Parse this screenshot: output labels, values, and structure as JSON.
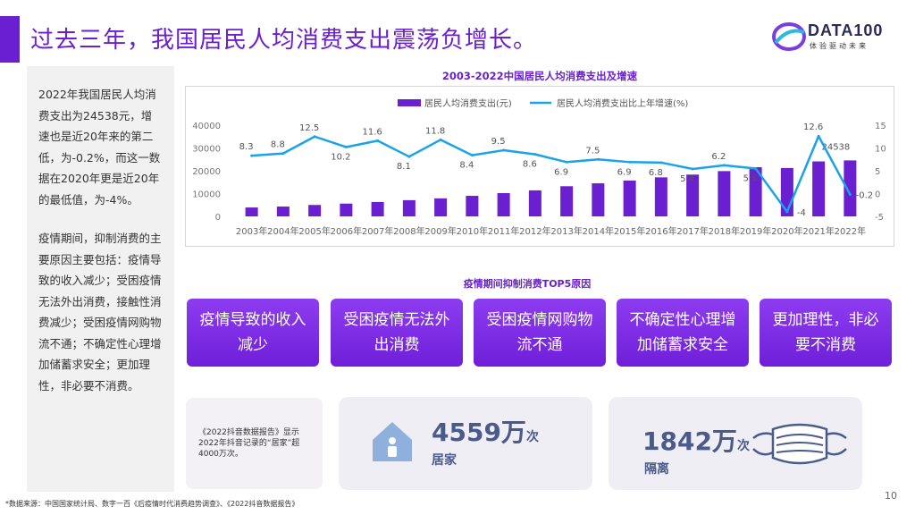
{
  "header": {
    "title": "过去三年，我国居民人均消费支出震荡负增长。",
    "logo_text": "DATA100",
    "logo_sub": "体验驱动未来"
  },
  "left_panel": {
    "para1": "2022年我国居民人均消费支出为24538元，增速也是近20年来的第二低，为-0.2%，而这一数据在2020年更是近20年的最低值，为-4%。",
    "para2": "疫情期间，抑制消费的主要原因主要包括：疫情导致的收入减少；受困疫情无法外出消费，接触性消费减少；受困疫情网购物流不通；不确定性心理增加储蓄求安全；更加理性，非必要不消费。"
  },
  "chart_data": {
    "type": "bar+line",
    "title": "2003-2022中国居民人均消费支出及增速",
    "categories": [
      "2003年",
      "2004年",
      "2005年",
      "2006年",
      "2007年",
      "2008年",
      "2009年",
      "2010年",
      "2011年",
      "2012年",
      "2013年",
      "2014年",
      "2015年",
      "2016年",
      "2017年",
      "2018年",
      "2019年",
      "2020年",
      "2021年",
      "2022年"
    ],
    "series": [
      {
        "name": "居民人均消费支出(元)",
        "kind": "bar",
        "axis": "left",
        "color": "#6a1fd0",
        "values": [
          3900,
          4300,
          5000,
          5600,
          6300,
          7100,
          7900,
          9000,
          10200,
          11400,
          13220,
          14491,
          15712,
          17111,
          18322,
          19853,
          21559,
          21210,
          24100,
          24538
        ],
        "labeled": {
          "19": "24538"
        }
      },
      {
        "name": "居民人均消费支出比上年增速(%)",
        "kind": "line",
        "axis": "right",
        "color": "#1aa3e8",
        "values": [
          8.3,
          8.8,
          12.5,
          10.2,
          11.6,
          8.1,
          11.8,
          8.4,
          9.5,
          8.6,
          6.9,
          7.5,
          6.9,
          6.8,
          5.4,
          6.2,
          5.5,
          -4,
          12.6,
          -0.2
        ],
        "labels": [
          "8.3",
          "8.8",
          "12.5",
          "10.2",
          "11.6",
          "8.1",
          "11.8",
          "8.4",
          "9.5",
          "8.6",
          "6.9",
          "7.5",
          "6.9",
          "6.8",
          "5.4",
          "6.2",
          "5.5",
          "-4",
          "12.6",
          "-0.2"
        ]
      }
    ],
    "y_left": {
      "min": 0,
      "max": 40000,
      "ticks": [
        "0",
        "10000",
        "20000",
        "30000",
        "40000"
      ]
    },
    "y_right": {
      "min": -5,
      "max": 15,
      "ticks": [
        "-5",
        "0",
        "5",
        "10",
        "15"
      ]
    },
    "legend_position": "top-center",
    "grid": false
  },
  "top5": {
    "title": "疫情期间抑制消费TOP5原因",
    "reasons": [
      "疫情导致的收入减少",
      "受困疫情无法外出消费",
      "受困疫情网购物流不通",
      "不确定性心理增加储蓄求安全",
      "更加理性，非必要不消费"
    ]
  },
  "stats": {
    "note": "《2022抖音数据报告》显示2022年抖音记录的“居家”超4000万次。",
    "home": {
      "value": "4559万",
      "unit": "次",
      "label": "居家"
    },
    "isolation": {
      "value": "1842万",
      "unit": "次",
      "label": "隔离"
    }
  },
  "footer": {
    "source": "*数据来源：中国国家统计局、数字一百《后疫情时代消费趋势调查》、《2022抖音数据报告》",
    "page": "10"
  },
  "colors": {
    "accent": "#6a1fd0",
    "line": "#1aa3e8"
  }
}
